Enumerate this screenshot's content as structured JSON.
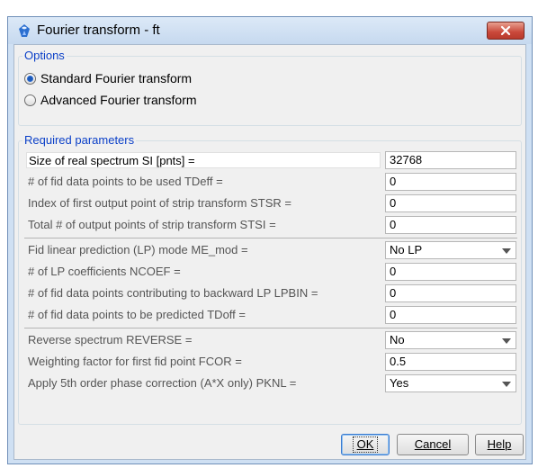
{
  "window": {
    "title": "Fourier transform - ft",
    "close_label": "x"
  },
  "options": {
    "legend": "Options",
    "radios": [
      {
        "label": "Standard Fourier transform",
        "checked": true
      },
      {
        "label": "Advanced Fourier transform",
        "checked": false
      }
    ]
  },
  "params": {
    "legend": "Required parameters",
    "rows": [
      {
        "label": "Size of real spectrum SI [pnts] =",
        "value": "32768",
        "kind": "input"
      },
      {
        "label": "# of fid data points to be used TDeff =",
        "value": "0",
        "kind": "input"
      },
      {
        "label": "Index of first output point of strip transform STSR =",
        "value": "0",
        "kind": "input"
      },
      {
        "label": "Total # of output points of strip transform STSI =",
        "value": "0",
        "kind": "input"
      },
      {
        "label": "Fid linear prediction (LP) mode ME_mod =",
        "value": "No LP",
        "kind": "select"
      },
      {
        "label": "# of LP coefficients NCOEF =",
        "value": "0",
        "kind": "input"
      },
      {
        "label": "# of fid data points contributing to backward LP LPBIN =",
        "value": "0",
        "kind": "input"
      },
      {
        "label": "# of fid data points to be predicted TDoff =",
        "value": "0",
        "kind": "input"
      },
      {
        "label": "Reverse spectrum REVERSE =",
        "value": "No",
        "kind": "select"
      },
      {
        "label": "Weighting factor for first fid point FCOR =",
        "value": "0.5",
        "kind": "input"
      },
      {
        "label": "Apply 5th order phase correction (A*X only) PKNL =",
        "value": "Yes",
        "kind": "select"
      }
    ]
  },
  "buttons": {
    "ok": "OK",
    "cancel": "Cancel",
    "help": "Help"
  },
  "icons": {
    "app": "bruker-topspin-icon",
    "close": "close-icon",
    "dropdown": "chevron-down-icon"
  }
}
